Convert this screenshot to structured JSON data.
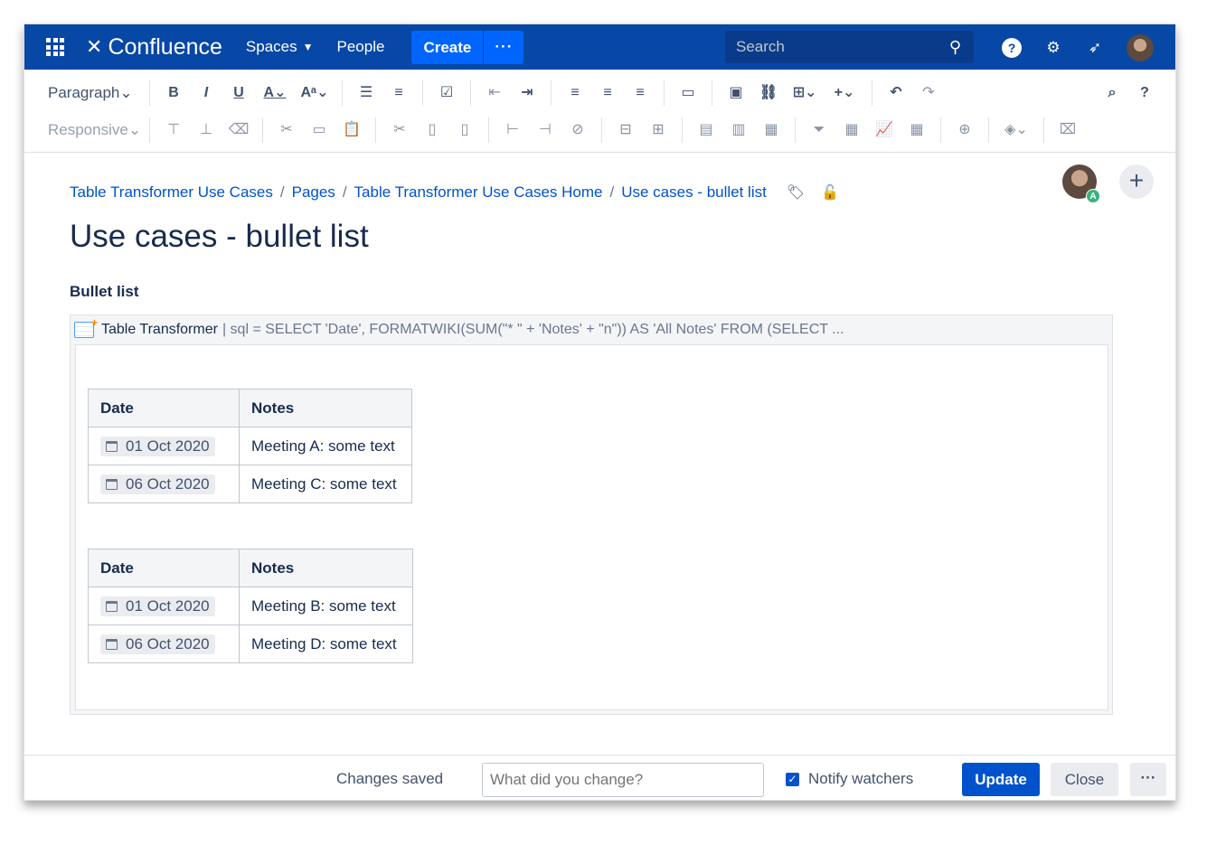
{
  "nav": {
    "app_name": "Confluence",
    "spaces_label": "Spaces",
    "people_label": "People",
    "create_label": "Create",
    "more_label": "···",
    "search_placeholder": "Search",
    "help_label": "?"
  },
  "toolbar": {
    "paragraph_label": "Paragraph",
    "responsive_label": "Responsive",
    "search_label": "⌕",
    "help_label": "?"
  },
  "breadcrumb": [
    "Table Transformer Use Cases",
    "Pages",
    "Table Transformer Use Cases Home",
    "Use cases - bullet list"
  ],
  "breadcrumb_sep": "/",
  "page_title": "Use cases - bullet list",
  "avatar_badge": "A",
  "section_heading": "Bullet list",
  "macro": {
    "name": "Table Transformer",
    "params": "| sql = SELECT 'Date', FORMATWIKI(SUM(\"* \" + 'Notes' + \"n\")) AS 'All Notes' FROM (SELECT ..."
  },
  "tables": [
    {
      "headers": [
        "Date",
        "Notes"
      ],
      "rows": [
        [
          "01 Oct 2020",
          "Meeting A: some text"
        ],
        [
          "06 Oct 2020",
          "Meeting C: some text"
        ]
      ]
    },
    {
      "headers": [
        "Date",
        "Notes"
      ],
      "rows": [
        [
          "01 Oct 2020",
          "Meeting B: some text"
        ],
        [
          "06 Oct 2020",
          "Meeting D: some text"
        ]
      ]
    }
  ],
  "footer": {
    "status": "Changes saved",
    "comment_placeholder": "What did you change?",
    "notify_label": "Notify watchers",
    "notify_checked": true,
    "update_label": "Update",
    "close_label": "Close",
    "more_label": "···"
  },
  "colors": {
    "nav_bg": "#0747a6",
    "create_bg": "#0065ff",
    "link": "#0052cc",
    "primary_button": "#0052cc"
  }
}
